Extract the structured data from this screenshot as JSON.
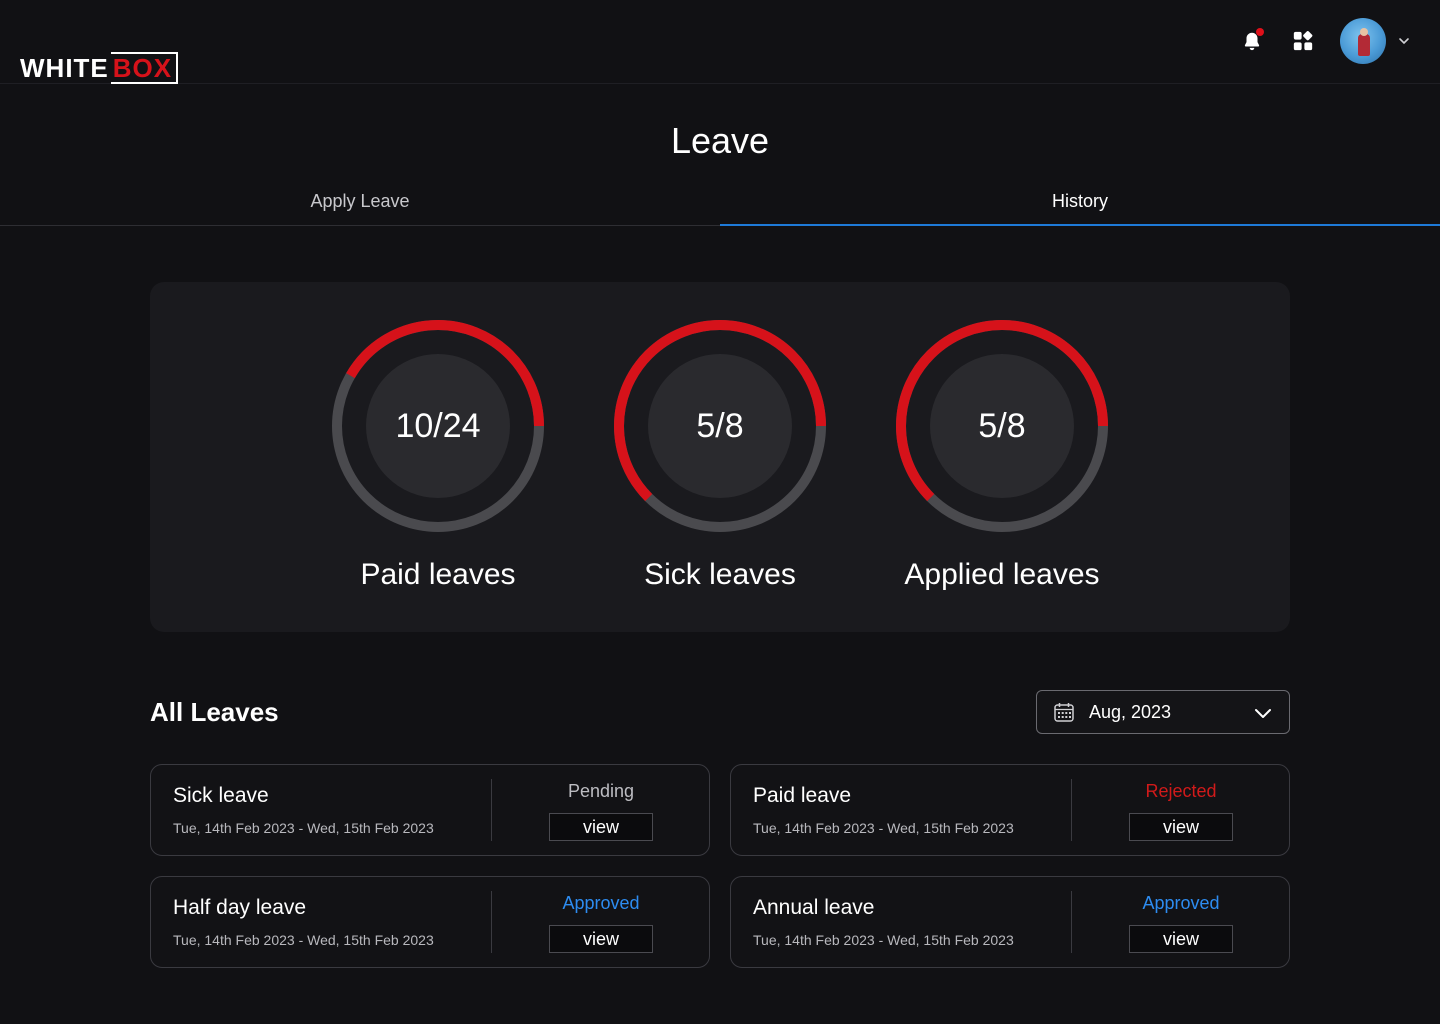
{
  "header": {
    "logo_white": "WHITE",
    "logo_box": "BOX"
  },
  "page_title": "Leave",
  "tabs": [
    {
      "label": "Apply Leave",
      "active": false
    },
    {
      "label": "History",
      "active": true
    }
  ],
  "stats": [
    {
      "value": "10/24",
      "label": "Paid leaves",
      "used": 10,
      "total": 24
    },
    {
      "value": "5/8",
      "label": "Sick leaves",
      "used": 5,
      "total": 8
    },
    {
      "value": "5/8",
      "label": "Applied leaves",
      "used": 5,
      "total": 8
    }
  ],
  "all_leaves": {
    "title": "All Leaves",
    "month_filter": "Aug, 2023",
    "view_label": "view",
    "items": [
      {
        "type": "Sick leave",
        "dates": "Tue, 14th Feb 2023 - Wed, 15th Feb 2023",
        "status": "Pending"
      },
      {
        "type": "Paid leave",
        "dates": "Tue, 14th Feb 2023 - Wed, 15th Feb 2023",
        "status": "Rejected"
      },
      {
        "type": "Half day leave",
        "dates": "Tue, 14th Feb 2023 - Wed, 15th Feb 2023",
        "status": "Approved"
      },
      {
        "type": "Annual leave",
        "dates": "Tue, 14th Feb 2023 - Wed, 15th Feb 2023",
        "status": "Approved"
      }
    ]
  },
  "colors": {
    "accent_red": "#d6121a",
    "ring_track": "#4a4a4e",
    "tab_underline": "#1e7ad8",
    "status_pending": "#bdbdc2",
    "status_rejected": "#d11a1a",
    "status_approved": "#2d8cf0"
  }
}
